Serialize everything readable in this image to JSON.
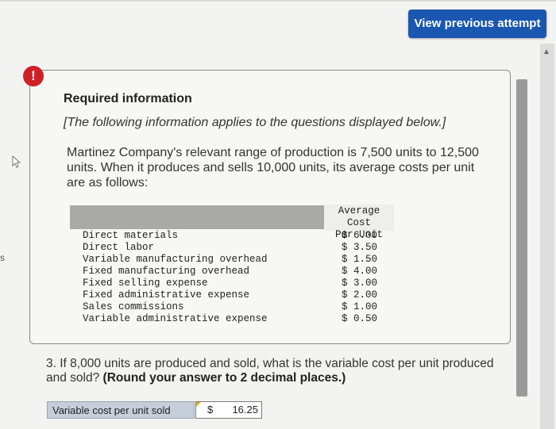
{
  "header": {
    "view_previous_attempt": "View previous attempt"
  },
  "side": {
    "cut_label": "s"
  },
  "panel": {
    "title": "Required information",
    "subtitle": "[The following information applies to the questions displayed below.]",
    "intro": "Martinez Company's relevant range of production is 7,500 units to 12,500 units. When it produces and sells 10,000 units, its average costs per unit are as follows:",
    "table": {
      "header_line1": "Average Cost",
      "header_line2": "Per Unit",
      "rows": [
        {
          "label": "Direct materials",
          "value": "$ 6.00"
        },
        {
          "label": "Direct labor",
          "value": "$ 3.50"
        },
        {
          "label": "Variable manufacturing overhead",
          "value": "$ 1.50"
        },
        {
          "label": "Fixed manufacturing overhead",
          "value": "$ 4.00"
        },
        {
          "label": "Fixed selling expense",
          "value": "$ 3.00"
        },
        {
          "label": "Fixed administrative expense",
          "value": "$ 2.00"
        },
        {
          "label": "Sales commissions",
          "value": "$ 1.00"
        },
        {
          "label": "Variable administrative expense",
          "value": "$ 0.50"
        }
      ]
    }
  },
  "question": {
    "text": "3. If 8,000 units are produced and sold, what is the variable cost per unit produced and sold?",
    "instruction": "(Round your answer to 2 decimal places.)"
  },
  "answer": {
    "label": "Variable cost per unit sold",
    "currency": "$",
    "value": "16.25"
  },
  "colors": {
    "button": "#1a57b0",
    "alert": "#cf2027",
    "answer_label_bg": "#c6ced9"
  },
  "icons": [
    "alert-icon",
    "cursor-icon",
    "scroll-up-icon"
  ]
}
